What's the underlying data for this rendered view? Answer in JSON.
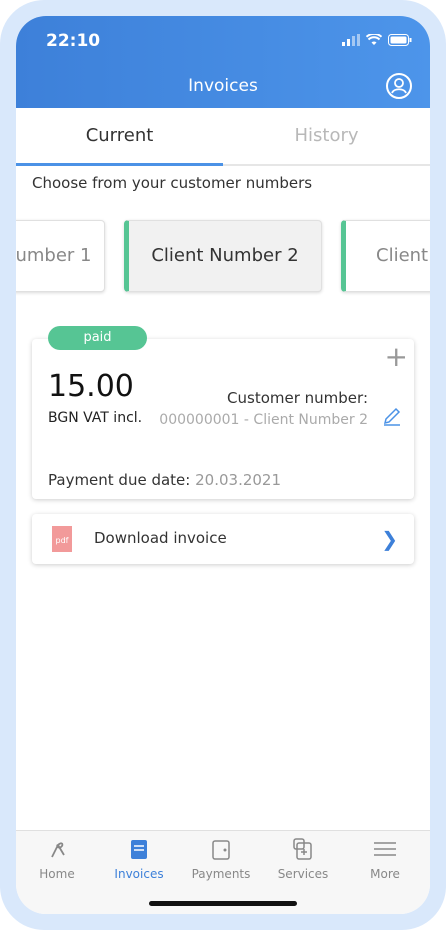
{
  "status": {
    "time": "22:10"
  },
  "header": {
    "title": "Invoices"
  },
  "tabs": [
    {
      "label": "Current"
    },
    {
      "label": "History"
    }
  ],
  "choose_text": "Choose from your customer numbers",
  "clients": [
    {
      "label": "umber 1"
    },
    {
      "label": "Client Number 2"
    },
    {
      "label": "Client"
    }
  ],
  "invoice": {
    "status": "paid",
    "amount": "15.00",
    "currency": "BGN VAT incl.",
    "customer_label": "Customer number:",
    "customer_value": "000000001 - Client Number 2",
    "due_label": "Payment due date:",
    "due_value": "20.03.2021"
  },
  "download": {
    "icon_label": "pdf",
    "label": "Download invoice"
  },
  "nav": [
    {
      "label": "Home",
      "icon": "home-icon"
    },
    {
      "label": "Invoices",
      "icon": "invoice-icon"
    },
    {
      "label": "Payments",
      "icon": "wallet-icon"
    },
    {
      "label": "Services",
      "icon": "services-icon"
    },
    {
      "label": "More",
      "icon": "menu-icon"
    }
  ],
  "colors": {
    "header": "#3d80d9",
    "accent_green": "#56c594",
    "active": "#3d80d9"
  }
}
